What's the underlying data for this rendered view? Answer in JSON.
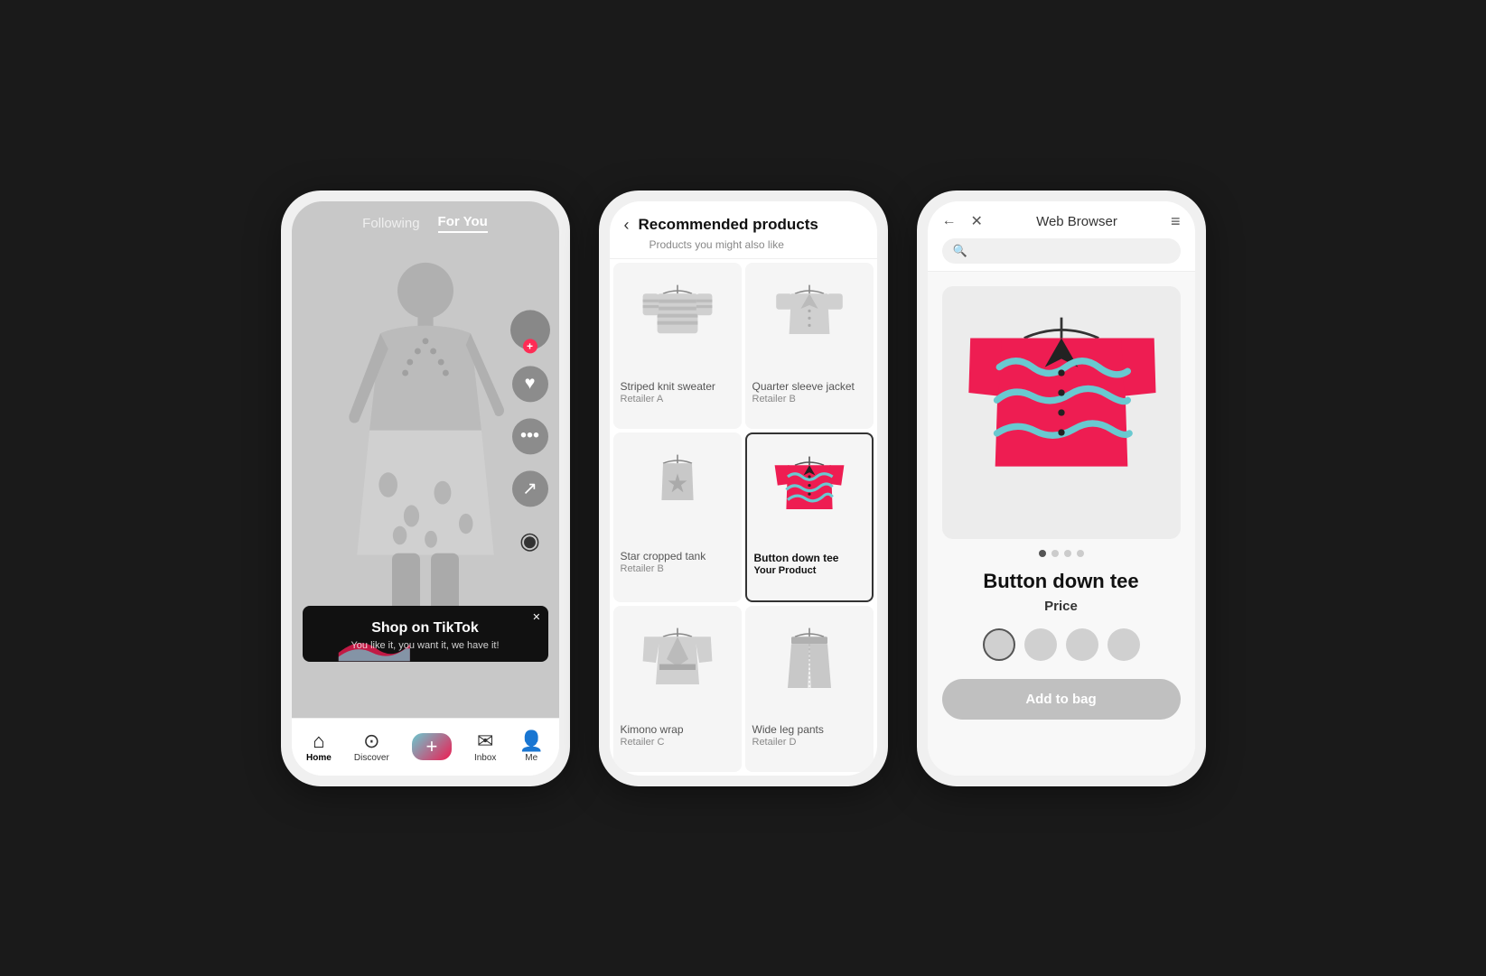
{
  "phone1": {
    "header": {
      "following_label": "Following",
      "for_you_label": "For You"
    },
    "ad": {
      "title": "Shop on TikTok",
      "subtitle": "You like it, you want it, we have it!",
      "close_label": "✕"
    },
    "nav": {
      "home_label": "Home",
      "discover_label": "Discover",
      "plus_label": "+",
      "inbox_label": "Inbox",
      "me_label": "Me"
    }
  },
  "phone2": {
    "header": {
      "back_icon": "‹",
      "title": "Recommended products",
      "subtitle": "Products you might also like"
    },
    "products": [
      {
        "name": "Striped knit sweater",
        "retailer": "Retailer A",
        "highlighted": false,
        "type": "sweater"
      },
      {
        "name": "Quarter sleeve jacket",
        "retailer": "Retailer B",
        "highlighted": false,
        "type": "jacket"
      },
      {
        "name": "Star cropped tank",
        "retailer": "Retailer B",
        "highlighted": false,
        "type": "tank"
      },
      {
        "name": "Button down tee",
        "retailer": "Your Product",
        "highlighted": true,
        "type": "tee-colorful"
      },
      {
        "name": "Kimono wrap",
        "retailer": "Retailer C",
        "highlighted": false,
        "type": "kimono"
      },
      {
        "name": "Wide leg pants",
        "retailer": "Retailer D",
        "highlighted": false,
        "type": "pants"
      }
    ]
  },
  "phone3": {
    "header": {
      "back_icon": "←",
      "close_icon": "✕",
      "title": "Web Browser",
      "menu_icon": "≡",
      "search_placeholder": ""
    },
    "product": {
      "title": "Button down tee",
      "price_label": "Price",
      "add_to_bag_label": "Add to bag"
    },
    "carousel_dots": [
      true,
      false,
      false,
      false
    ],
    "colors": [
      {
        "selected": true
      },
      {
        "selected": false
      },
      {
        "selected": false
      },
      {
        "selected": false
      }
    ]
  }
}
